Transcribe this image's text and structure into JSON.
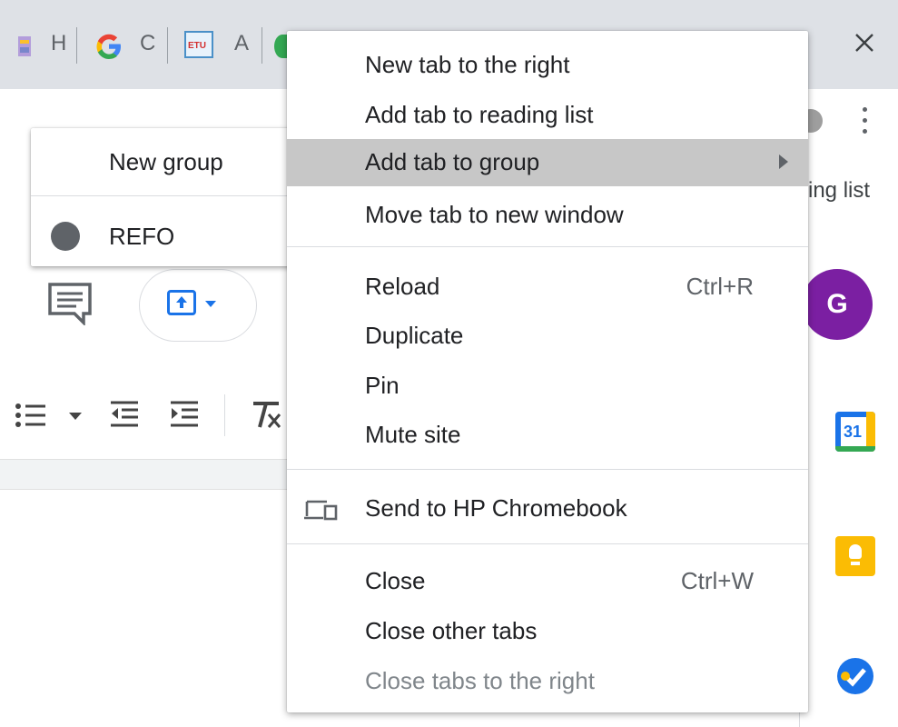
{
  "tab_strip": {
    "fragments": [
      "H",
      "C",
      "ETU",
      "A"
    ]
  },
  "toolbar": {
    "reading_list_fragment": "ing list",
    "avatar_letter": "G"
  },
  "calendar_icon_text": "31",
  "submenu": {
    "new_group_label": "New group",
    "groups": [
      {
        "label": "REFO",
        "color": "#5f6368"
      }
    ]
  },
  "context_menu": {
    "section1": [
      {
        "label": "New tab to the right"
      },
      {
        "label": "Add tab to reading list"
      },
      {
        "label": "Add tab to group",
        "has_submenu": true,
        "highlighted": true
      },
      {
        "label": "Move tab to new window"
      }
    ],
    "section2": [
      {
        "label": "Reload",
        "shortcut": "Ctrl+R"
      },
      {
        "label": "Duplicate"
      },
      {
        "label": "Pin"
      },
      {
        "label": "Mute site"
      }
    ],
    "section3": [
      {
        "label": "Send to HP Chromebook",
        "icon": "devices-icon"
      }
    ],
    "section4": [
      {
        "label": "Close",
        "shortcut": "Ctrl+W"
      },
      {
        "label": "Close other tabs"
      },
      {
        "label": "Close tabs to the right",
        "disabled": true
      }
    ]
  },
  "colors": {
    "highlight": "#c7c7c7",
    "accent": "#1a73e8",
    "avatar": "#7b1fa2"
  }
}
